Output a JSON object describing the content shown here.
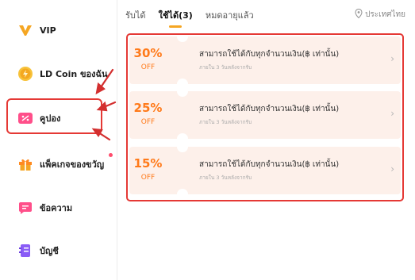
{
  "sidebar": {
    "items": [
      {
        "label": "VIP",
        "icon": "vip-icon"
      },
      {
        "label": "LD Coin ของฉัน",
        "icon": "coin-icon"
      },
      {
        "label": "คูปอง",
        "icon": "coupon-icon"
      },
      {
        "label": "แพ็คเกจของขวัญ",
        "icon": "gift-icon"
      },
      {
        "label": "ข้อความ",
        "icon": "message-icon"
      },
      {
        "label": "บัญชี",
        "icon": "account-icon"
      }
    ],
    "active": "คูปอง"
  },
  "tabs": [
    {
      "label": "รับได้"
    },
    {
      "label": "ใช้ได้(3)",
      "active": true
    },
    {
      "label": "หมดอายุแล้ว"
    }
  ],
  "region": {
    "label": "ประเทศไทย",
    "icon": "location-pin-icon"
  },
  "coupons": [
    {
      "discount": "30%",
      "off": "OFF",
      "title": "สามารถใช้ได้กับทุกจำนวนเงิน(฿ เท่านั้น)",
      "expiry": "ภายใน 3 วันหลังจากรับ"
    },
    {
      "discount": "25%",
      "off": "OFF",
      "title": "สามารถใช้ได้กับทุกจำนวนเงิน(฿ เท่านั้น)",
      "expiry": "ภายใน 3 วันหลังจากรับ"
    },
    {
      "discount": "15%",
      "off": "OFF",
      "title": "สามารถใช้ได้กับทุกจำนวนเงิน(฿ เท่านั้น)",
      "expiry": "ภายใน 3 วันหลังจากรับ"
    }
  ],
  "colors": {
    "accent": "#ff7a1a",
    "highlight": "#e53935",
    "tab_underline": "#f5a623",
    "coupon_bg": "#fdf0ea"
  }
}
